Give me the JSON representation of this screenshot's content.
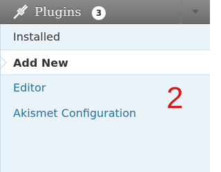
{
  "menu": {
    "title": "Plugins",
    "badge_count": "3",
    "icon": "plug-icon",
    "items": [
      {
        "label": "Installed"
      },
      {
        "label": "Add New",
        "current": true
      },
      {
        "label": "Editor"
      },
      {
        "label": "Akismet Configuration"
      }
    ]
  },
  "annotation": {
    "label": "2",
    "color": "#d41b14"
  },
  "colors": {
    "header": "#7b7b7b",
    "submenu_bg": "#eaf2fa",
    "link": "#21759b"
  }
}
